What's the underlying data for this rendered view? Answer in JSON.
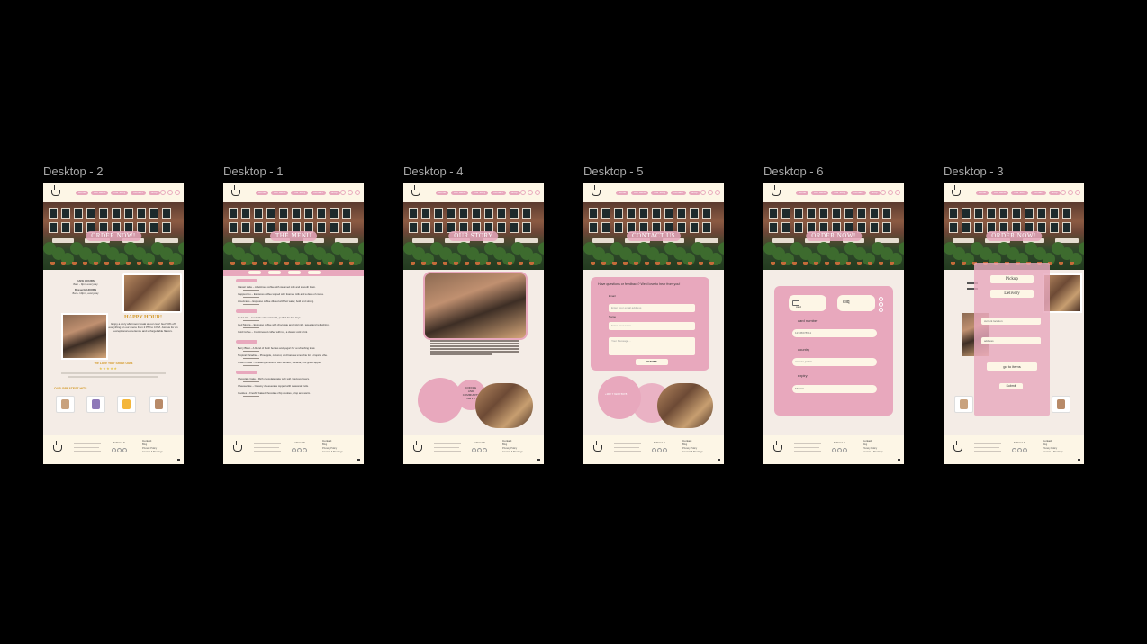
{
  "frames": [
    {
      "label": "Desktop - 2",
      "hero": "ORDER NOW!",
      "hours1": "CAFE HOURS",
      "hours1_time": "8am - 9pm everyday",
      "hours2": "Desserts HOURS",
      "hours2_time": "8am- 10pm, everyday",
      "happy_title": "HAPPY HOUR!",
      "happy_text": "Enjoy a cozy afternoon break at our cafe! Get 50% off everything on our menu from 2 PM to 4 PM. Join us for an exceptional experience and unforgettable flavors.",
      "reviews_title": "We Love Your Shout Outs",
      "greatest": "OUR GREATEST HITS"
    },
    {
      "label": "Desktop - 1",
      "hero": "THE MENU",
      "menu_lines": [
        "Classic Latte – A delicious coffee with steamed milk and smooth foam.",
        "Cappuccino – Espresso coffee topped with foamed milk and a dash of cocoa.",
        "Americano – Espresso coffee diluted with hot water, bold and strong.",
        "Iced Latte – Iced latte with cold milk, perfect for hot days.",
        "Iced Mocha – Espresso coffee with chocolate and cold milk, sweet and refreshing.",
        "Cold Coffee – Cold-brewed coffee with ice, a classic cold drink.",
        "Berry Blast – A blend of fresh berries and yogurt for a refreshing treat.",
        "Tropical Paradise – Pineapple, coconut, and banana smoothie for a tropical vibe.",
        "Green Power – A healthy smoothie with spinach, banana, and green apple.",
        "Chocolate Cake – Rich chocolate cake with soft, luscious layers.",
        "Cheesecake – Creamy cheesecake topped with seasonal fruits.",
        "Cookies – Freshly baked chocolate chip cookies, crisp and warm."
      ]
    },
    {
      "label": "Desktop - 4",
      "hero": "OUR STORY",
      "story_words": [
        "COFFEE",
        "AND",
        "COMMUNITY",
        "WE'VE"
      ]
    },
    {
      "label": "Desktop - 5",
      "hero": "CONTACT US",
      "contact_title": "Have questions or feedback? We'd love to hear from you!",
      "email_label": "Email",
      "email_placeholder": "Enter your email address",
      "name_label": "Name",
      "name_placeholder": "Enter your name",
      "message_placeholder": "Your Message...",
      "submit": "SUBMIT",
      "phone": "+962 7 9228 5678"
    },
    {
      "label": "Desktop - 6",
      "hero": "ORDER NOW!",
      "pay_card": "card",
      "pay_cliq": "cliq",
      "card_number_label": "card number",
      "card_number_value": "12345678911",
      "country_label": "country",
      "country_value": "amman jordan",
      "expiry_label": "expiry",
      "expiry_value": "MM/YY"
    },
    {
      "label": "Desktop - 3",
      "hero": "ORDER NOW!",
      "pickup": "Pickup",
      "delivery": "Delivery",
      "current_location": "current location",
      "address": "address",
      "go_to_items": "go to items",
      "submit": "Submit"
    }
  ],
  "footer": {
    "col1": "Follow Us",
    "col2": "Contact",
    "links": [
      "Blog",
      "Privacy Policy",
      "Contact & Bookings"
    ]
  },
  "nav_pills": [
    "Home",
    "Our Menu",
    "Our Story",
    "Contact",
    "Shop"
  ],
  "colors": {
    "pink": "#e8a8bd",
    "cream": "#fdf6e6",
    "bg": "#f4ece6",
    "accent": "#d49a2a"
  }
}
